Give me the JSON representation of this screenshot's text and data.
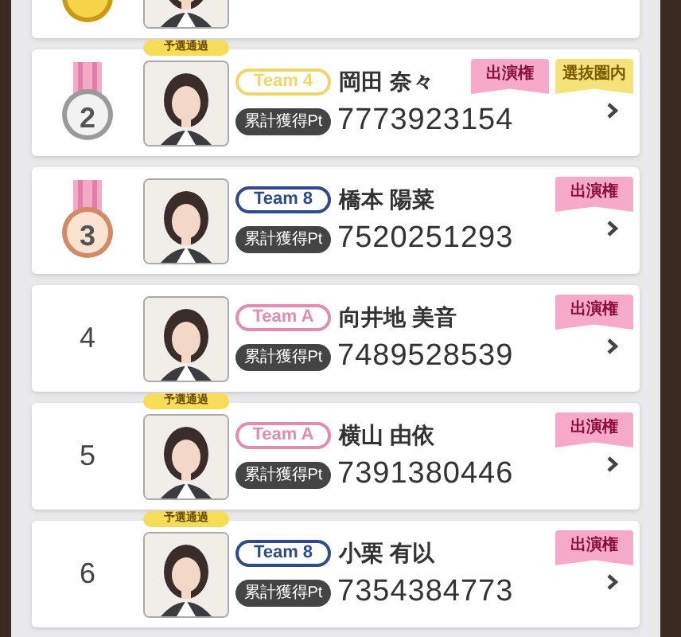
{
  "rows": [
    {
      "kind": "gold",
      "ribbons": []
    },
    {
      "rank": "2",
      "kind": "silver",
      "qualified": true,
      "badge": "予選通過",
      "team": "Team 4",
      "color": "#f0d66a",
      "name": "岡田 奈々",
      "points_label": "累計獲得Pt",
      "points": "7773923154",
      "ribbons": [
        {
          "kind": "pink",
          "label": "出演権"
        },
        {
          "kind": "yellow",
          "label": "選抜圏内"
        }
      ]
    },
    {
      "rank": "3",
      "kind": "bronze",
      "qualified": false,
      "team": "Team 8",
      "color": "#2f4a8a",
      "name": "橋本 陽菜",
      "points_label": "累計獲得Pt",
      "points": "7520251293",
      "ribbons": [
        {
          "kind": "pink",
          "label": "出演権"
        }
      ]
    },
    {
      "rank": "4",
      "qualified": false,
      "team": "Team A",
      "color": "#e28bb3",
      "name": "向井地 美音",
      "points_label": "累計獲得Pt",
      "points": "7489528539",
      "ribbons": [
        {
          "kind": "pink",
          "label": "出演権"
        }
      ]
    },
    {
      "rank": "5",
      "qualified": true,
      "badge": "予選通過",
      "team": "Team A",
      "color": "#e28bb3",
      "name": "横山 由依",
      "points_label": "累計獲得Pt",
      "points": "7391380446",
      "ribbons": [
        {
          "kind": "pink",
          "label": "出演権"
        }
      ]
    },
    {
      "rank": "6",
      "qualified": true,
      "badge": "予選通過",
      "team": "Team 8",
      "color": "#2f4a8a",
      "name": "小栗 有以",
      "points_label": "累計獲得Pt",
      "points": "7354384773",
      "ribbons": [
        {
          "kind": "pink",
          "label": "出演権"
        }
      ]
    }
  ]
}
